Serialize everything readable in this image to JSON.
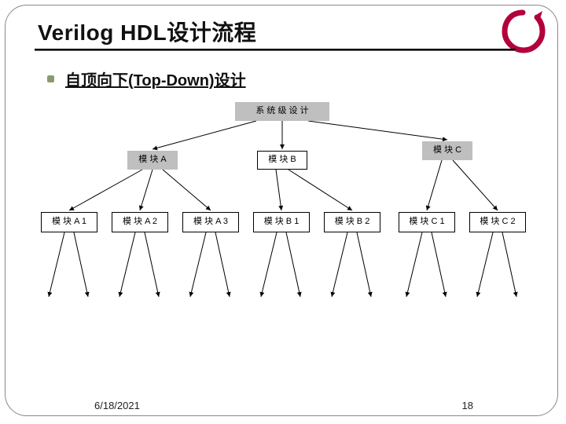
{
  "title": "Verilog HDL设计流程",
  "bullet": "自顶向下(Top-Down)设计",
  "footer": {
    "date": "6/18/2021",
    "page": "18"
  },
  "diagram": {
    "root": "系 统 级 设 计",
    "level1": [
      "模 块 A",
      "模 块 B",
      "模 块 C"
    ],
    "level2": [
      "模 块 A 1",
      "模 块 A 2",
      "模 块 A 3",
      "模 块 B 1",
      "模 块 B 2",
      "模 块 C 1",
      "模 块 C 2"
    ]
  }
}
